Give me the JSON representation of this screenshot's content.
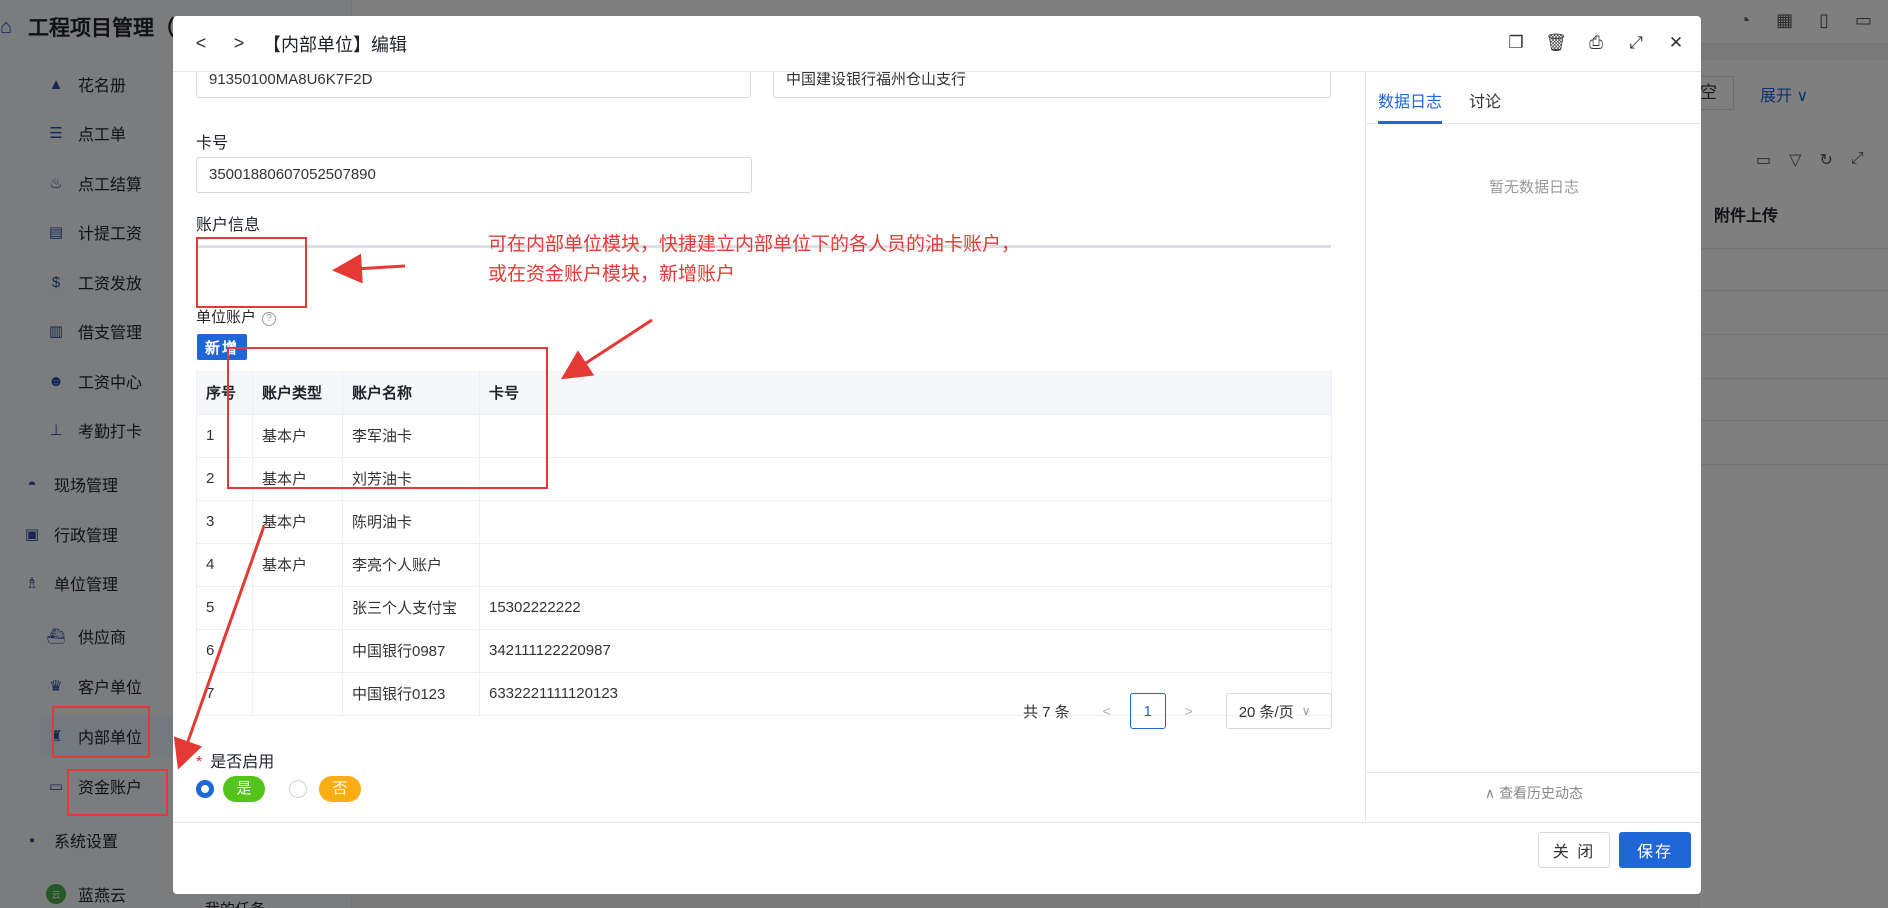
{
  "app": {
    "title": "工程项目管理（市",
    "nav": [
      {
        "label": "花名册",
        "icon": "roster-icon"
      },
      {
        "label": "点工单",
        "icon": "list-icon"
      },
      {
        "label": "点工结算",
        "icon": "settle-icon"
      },
      {
        "label": "计提工资",
        "icon": "doc-icon"
      },
      {
        "label": "工资发放",
        "icon": "dollar-icon"
      },
      {
        "label": "借支管理",
        "icon": "file-icon"
      },
      {
        "label": "工资中心",
        "icon": "team-icon"
      },
      {
        "label": "考勤打卡",
        "icon": "pin-icon"
      },
      {
        "label": "现场管理",
        "icon": "helmet-icon"
      },
      {
        "label": "行政管理",
        "icon": "cabinet-icon"
      },
      {
        "label": "单位管理",
        "icon": "building-icon"
      },
      {
        "label": "供应商",
        "icon": "ship-icon"
      },
      {
        "label": "客户单位",
        "icon": "crown-icon"
      },
      {
        "label": "内部单位",
        "icon": "org-icon"
      },
      {
        "label": "资金账户",
        "icon": "card-icon"
      },
      {
        "label": "系统设置",
        "icon": "save-icon"
      },
      {
        "label": "蓝燕云",
        "icon": "cloud-avatar-icon"
      }
    ],
    "bottom_partial": "我的任务",
    "right_bg": {
      "clear_label": "空",
      "expand_label": "展开",
      "column_header": "附件上传"
    }
  },
  "modal": {
    "title": "【内部单位】编辑",
    "fields": {
      "credit_code_value": "91350100MA8U6K7F2D",
      "bank_value": "中国建设银行福州仓山支行",
      "card_label": "卡号",
      "card_value": "35001880607052507890"
    },
    "section_title": "账户信息",
    "unit_account_label": "单位账户",
    "add_button": "新增",
    "table": {
      "headers": [
        "序号",
        "账户类型",
        "账户名称",
        "卡号"
      ],
      "rows": [
        [
          "1",
          "基本户",
          "李军油卡",
          ""
        ],
        [
          "2",
          "基本户",
          "刘芳油卡",
          ""
        ],
        [
          "3",
          "基本户",
          "陈明油卡",
          ""
        ],
        [
          "4",
          "基本户",
          "李亮个人账户",
          ""
        ],
        [
          "5",
          "",
          "张三个人支付宝",
          "15302222222"
        ],
        [
          "6",
          "",
          "中国银行0987",
          "342111122220987"
        ],
        [
          "7",
          "",
          "中国银行0123",
          "6332221111120123"
        ]
      ]
    },
    "pagination": {
      "total": "共 7 条",
      "current_page": "1",
      "page_size": "20 条/页"
    },
    "enable": {
      "label": "是否启用",
      "required_mark": "*",
      "yes": "是",
      "no": "否",
      "selected": "是"
    },
    "right_panel": {
      "tabs": [
        "数据日志",
        "讨论"
      ],
      "active_tab": "数据日志",
      "empty_text": "暂无数据日志",
      "history_link": "查看历史动态"
    },
    "footer": {
      "close": "关 闭",
      "save": "保存"
    }
  },
  "annotation": {
    "line1": "可在内部单位模块，快捷建立内部单位下的各人员的油卡账户，",
    "line2": "或在资金账户模块，新增账户"
  },
  "colors": {
    "primary": "#1f66d6",
    "annotation_red": "#e53935",
    "yes_green": "#52c41a",
    "no_orange": "#faad14"
  }
}
